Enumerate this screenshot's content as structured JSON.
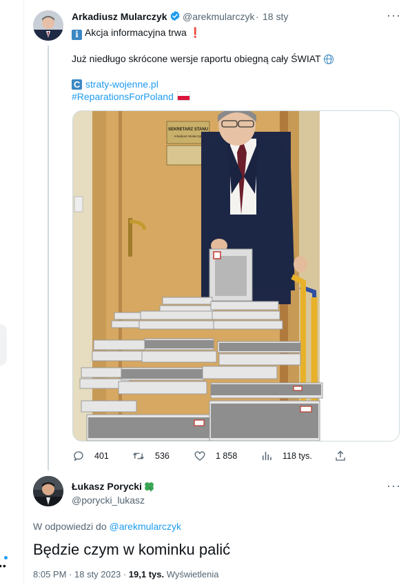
{
  "tweet1": {
    "name": "Arkadiusz Mularczyk",
    "handle": "@arekmularczyk",
    "time": "18 sty",
    "line1": "Akcja informacyjna trwa",
    "line2": "Już niedługo skrócone wersje raportu obiegną cały ŚWIAT",
    "link_text": "straty-wojenne.pl",
    "hashtag": "#ReparationsForPoland",
    "sign_label": "SEKRETARZ STANU",
    "sign_name": "Arkadiusz Mularczyk",
    "actions": {
      "replies": "401",
      "retweets": "536",
      "likes": "1 858",
      "views": "118 tys."
    }
  },
  "tweet2": {
    "name": "Łukasz Porycki",
    "handle": "@porycki_lukasz",
    "reply_prefix": "W odpowiedzi do",
    "reply_handle": "@arekmularczyk",
    "text": "Będzie czym w kominku palić",
    "time": "8:05 PM",
    "date": "18 sty 2023",
    "views_count": "19,1 tys.",
    "views_label": "Wyświetlenia"
  },
  "colors": {
    "accent": "#1d9bf0",
    "muted": "#536471",
    "text": "#0f1419",
    "border": "#cfd9de"
  },
  "icons": [
    "verified-badge-icon",
    "more-icon",
    "info-icon",
    "exclamation-icon",
    "globe-icon",
    "link-icon",
    "poland-flag-icon",
    "clover-icon",
    "reply-icon",
    "retweet-icon",
    "like-icon",
    "views-icon",
    "share-icon"
  ]
}
